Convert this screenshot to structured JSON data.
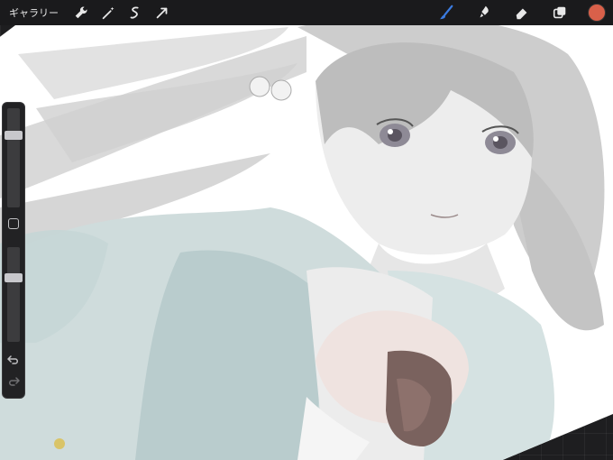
{
  "toolbar": {
    "gallery_label": "ギャラリー",
    "left_tools": [
      {
        "icon": "wrench-icon"
      },
      {
        "icon": "magic-wand-icon"
      },
      {
        "icon": "selection-icon"
      },
      {
        "icon": "transform-arrow-icon"
      }
    ],
    "right_tools": [
      {
        "icon": "brush-icon",
        "active": true
      },
      {
        "icon": "smudge-icon"
      },
      {
        "icon": "eraser-icon"
      },
      {
        "icon": "layers-icon"
      }
    ],
    "current_color": "#d9604a"
  },
  "sidebar": {
    "brush_size_level": 0.75,
    "opacity_level": 0.7,
    "icons": [
      "modify-square-icon",
      "undo-icon",
      "redo-icon"
    ]
  },
  "colors": {
    "brush_active": "#3b7be0",
    "toolbar_bg": "#1a1a1c",
    "canvas_bg": "#ffffff",
    "surround_bg": "#1e1e20"
  }
}
